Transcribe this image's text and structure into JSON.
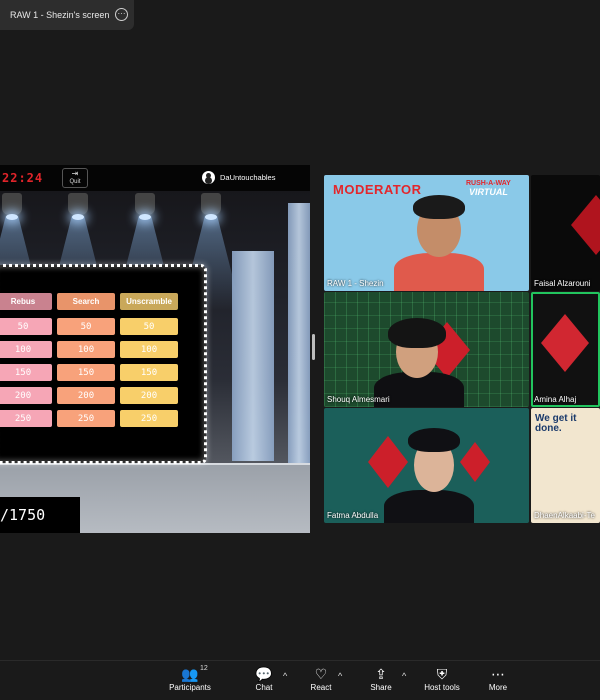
{
  "window": {
    "tab_title": "RAW 1 - Shezin's screen",
    "tab_more": "···"
  },
  "game": {
    "timer": "22:24",
    "quit_label": "Quit",
    "team_name": "DaUntouchables",
    "categories": [
      "Rebus",
      "Search",
      "Unscramble"
    ],
    "rows": [
      [
        "50",
        "50",
        "50"
      ],
      [
        "100",
        "100",
        "100"
      ],
      [
        "150",
        "150",
        "150"
      ],
      [
        "200",
        "200",
        "200"
      ],
      [
        "250",
        "250",
        "250"
      ]
    ],
    "score": "/1750"
  },
  "participants": [
    {
      "name": "RAW 1 - Shezin",
      "overlay_title": "MODERATOR",
      "overlay_brand_top": "RUSH-A-WAY",
      "overlay_brand_bottom": "VIRTUAL"
    },
    {
      "name": "Faisal Alzarouni"
    },
    {
      "name": "Shouq Almesmari"
    },
    {
      "name": "Amina Alhaj",
      "active_speaker": true
    },
    {
      "name": "Fatma Abdulla"
    },
    {
      "name": "DhaenAlkaabi-Te",
      "overlay_text": "We get it done."
    }
  ],
  "toolbar": {
    "participants_label": "Participants",
    "participants_count": "12",
    "chat_label": "Chat",
    "react_label": "React",
    "share_label": "Share",
    "host_tools_label": "Host tools",
    "more_label": "More"
  },
  "colors": {
    "accent_red": "#e3262b",
    "active_outline": "#22c55e",
    "rebus": "#f6a6b6",
    "search": "#f8a27b",
    "unscramble": "#f8cf6a"
  }
}
